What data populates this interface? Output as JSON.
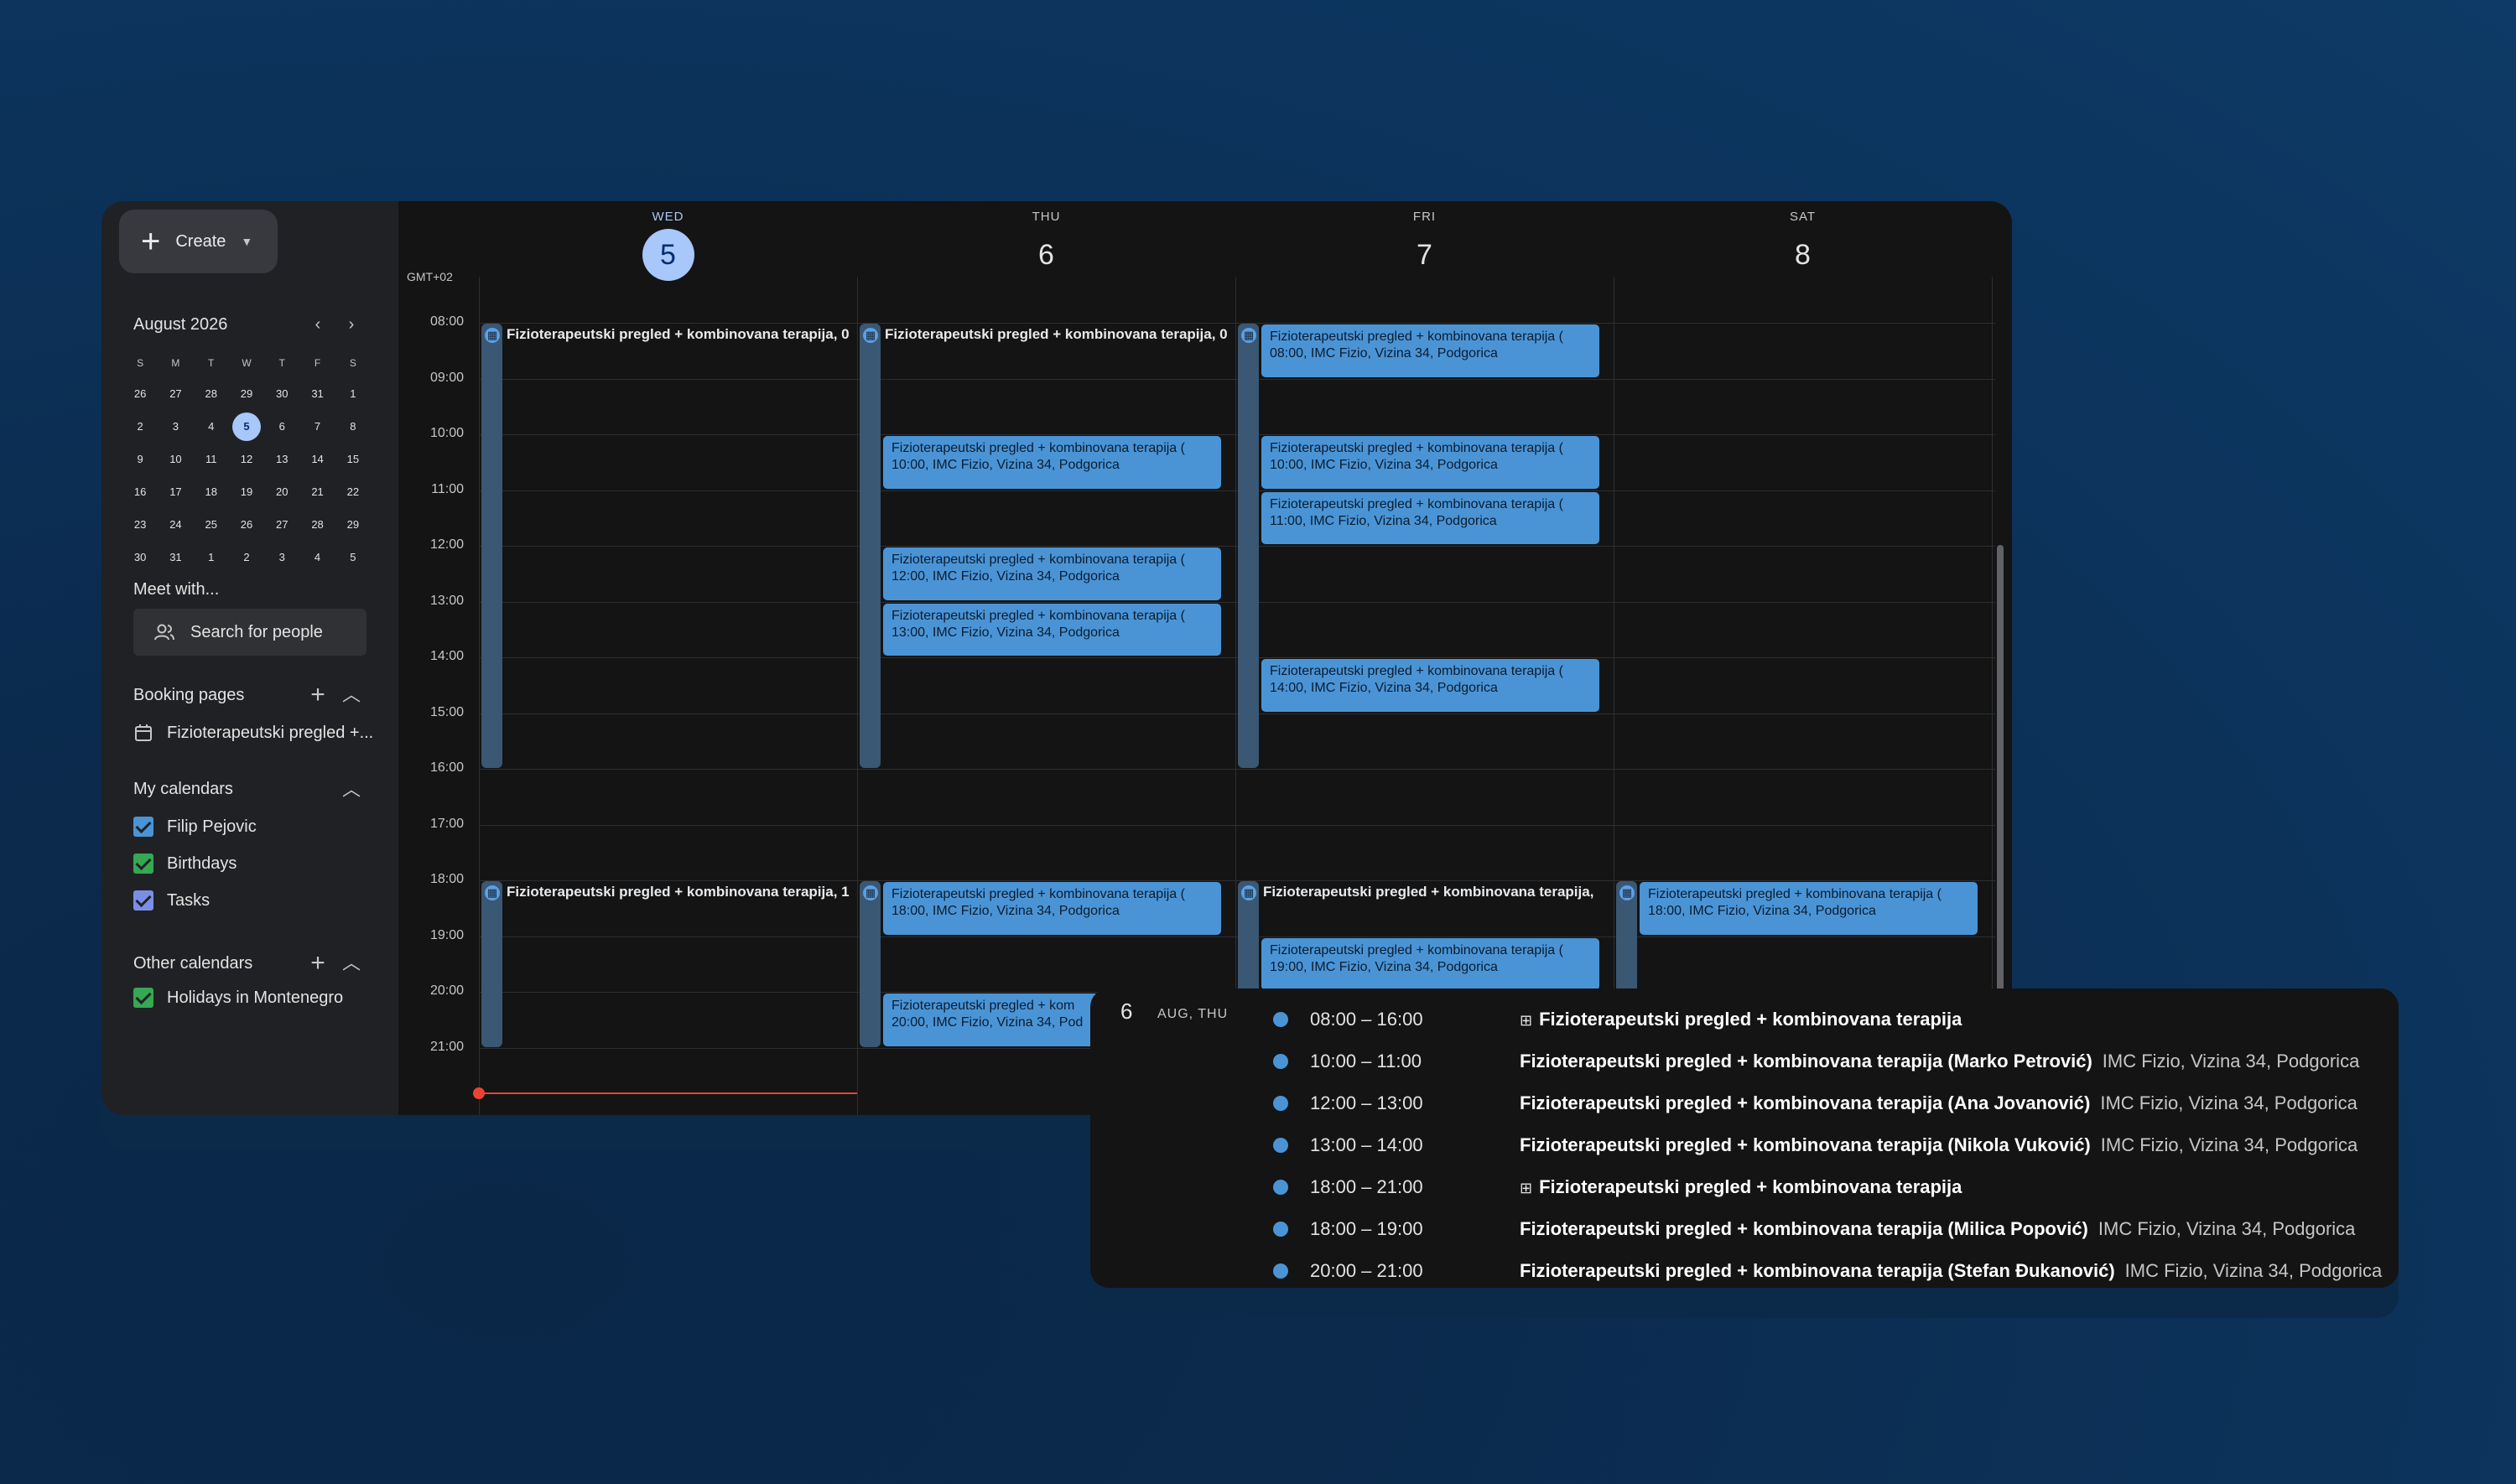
{
  "sidebar": {
    "create_label": "Create",
    "mini_calendar": {
      "month_label": "August 2026",
      "prev_icon": "‹",
      "next_icon": "›",
      "dows": [
        "S",
        "M",
        "T",
        "W",
        "T",
        "F",
        "S"
      ],
      "weeks": [
        [
          "26",
          "27",
          "28",
          "29",
          "30",
          "31",
          "1"
        ],
        [
          "2",
          "3",
          "4",
          "5",
          "6",
          "7",
          "8"
        ],
        [
          "9",
          "10",
          "11",
          "12",
          "13",
          "14",
          "15"
        ],
        [
          "16",
          "17",
          "18",
          "19",
          "20",
          "21",
          "22"
        ],
        [
          "23",
          "24",
          "25",
          "26",
          "27",
          "28",
          "29"
        ],
        [
          "30",
          "31",
          "1",
          "2",
          "3",
          "4",
          "5"
        ]
      ],
      "today": "5"
    },
    "meet_with": "Meet with...",
    "search_placeholder": "Search for people",
    "booking_pages": {
      "title": "Booking pages",
      "items": [
        "Fizioterapeutski pregled +..."
      ]
    },
    "my_calendars": {
      "title": "My calendars",
      "items": [
        {
          "label": "Filip Pejovic",
          "color": "#4a94d6"
        },
        {
          "label": "Birthdays",
          "color": "#34a853"
        },
        {
          "label": "Tasks",
          "color": "#7b8ee6"
        }
      ]
    },
    "other_calendars": {
      "title": "Other calendars",
      "items": [
        {
          "label": "Holidays in Montenegro",
          "color": "#34a853"
        }
      ]
    }
  },
  "grid": {
    "timezone": "GMT+02",
    "days": [
      {
        "dow": "WED",
        "num": "5",
        "today": true
      },
      {
        "dow": "THU",
        "num": "6",
        "today": false
      },
      {
        "dow": "FRI",
        "num": "7",
        "today": false
      },
      {
        "dow": "SAT",
        "num": "8",
        "today": false
      }
    ],
    "hours": [
      "08:00",
      "09:00",
      "10:00",
      "11:00",
      "12:00",
      "13:00",
      "14:00",
      "15:00",
      "16:00",
      "17:00",
      "18:00",
      "19:00",
      "20:00",
      "21:00"
    ],
    "allday_blocks": [
      {
        "day": 0,
        "start": 8,
        "end": 16,
        "title": "Fizioterapeutski pregled + kombinovana terapija, 0"
      },
      {
        "day": 1,
        "start": 8,
        "end": 16,
        "title": "Fizioterapeutski pregled + kombinovana terapija, 0"
      },
      {
        "day": 2,
        "start": 8,
        "end": 16,
        "title": ""
      },
      {
        "day": 0,
        "start": 18,
        "end": 21,
        "title": "Fizioterapeutski pregled + kombinovana terapija, 1"
      },
      {
        "day": 1,
        "start": 18,
        "end": 21,
        "title": ""
      },
      {
        "day": 2,
        "start": 18,
        "end": 21,
        "title": "Fizioterapeutski pregled + kombinovana terapija,"
      },
      {
        "day": 3,
        "start": 18,
        "end": 21,
        "title": ""
      }
    ],
    "events": [
      {
        "day": 2,
        "start": 8,
        "l1": "Fizioterapeutski pregled + kombinovana terapija (",
        "l2": "08:00, IMC Fizio, Vizina 34, Podgorica"
      },
      {
        "day": 1,
        "start": 10,
        "l1": "Fizioterapeutski pregled + kombinovana terapija (",
        "l2": "10:00, IMC Fizio, Vizina 34, Podgorica"
      },
      {
        "day": 2,
        "start": 10,
        "l1": "Fizioterapeutski pregled + kombinovana terapija (",
        "l2": "10:00, IMC Fizio, Vizina 34, Podgorica"
      },
      {
        "day": 2,
        "start": 11,
        "l1": "Fizioterapeutski pregled + kombinovana terapija (",
        "l2": "11:00, IMC Fizio, Vizina 34, Podgorica"
      },
      {
        "day": 1,
        "start": 12,
        "l1": "Fizioterapeutski pregled + kombinovana terapija (",
        "l2": "12:00, IMC Fizio, Vizina 34, Podgorica"
      },
      {
        "day": 1,
        "start": 13,
        "l1": "Fizioterapeutski pregled + kombinovana terapija (",
        "l2": "13:00, IMC Fizio, Vizina 34, Podgorica"
      },
      {
        "day": 2,
        "start": 14,
        "l1": "Fizioterapeutski pregled + kombinovana terapija (",
        "l2": "14:00, IMC Fizio, Vizina 34, Podgorica"
      },
      {
        "day": 1,
        "start": 18,
        "l1": "Fizioterapeutski pregled + kombinovana terapija (",
        "l2": "18:00, IMC Fizio, Vizina 34, Podgorica"
      },
      {
        "day": 3,
        "start": 18,
        "l1": "Fizioterapeutski pregled + kombinovana terapija (",
        "l2": "18:00, IMC Fizio, Vizina 34, Podgorica"
      },
      {
        "day": 2,
        "start": 19,
        "l1": "Fizioterapeutski pregled + kombinovana terapija (",
        "l2": "19:00, IMC Fizio, Vizina 34, Podgorica"
      },
      {
        "day": 1,
        "start": 20,
        "l1": "Fizioterapeutski pregled + kom",
        "l2": "20:00, IMC Fizio, Vizina 34, Pod"
      }
    ]
  },
  "agenda": {
    "day_num": "6",
    "day_label": "AUG, THU",
    "rows": [
      {
        "time": "08:00 – 16:00",
        "allday_icon": true,
        "title": "Fizioterapeutski pregled + kombinovana terapija",
        "location": ""
      },
      {
        "time": "10:00 – 11:00",
        "allday_icon": false,
        "title": "Fizioterapeutski pregled + kombinovana terapija (Marko Petrović)",
        "location": "IMC Fizio, Vizina 34, Podgorica"
      },
      {
        "time": "12:00 – 13:00",
        "allday_icon": false,
        "title": "Fizioterapeutski pregled + kombinovana terapija (Ana Jovanović)",
        "location": "IMC Fizio, Vizina 34, Podgorica"
      },
      {
        "time": "13:00 – 14:00",
        "allday_icon": false,
        "title": "Fizioterapeutski pregled + kombinovana terapija (Nikola Vuković)",
        "location": "IMC Fizio, Vizina 34, Podgorica"
      },
      {
        "time": "18:00 – 21:00",
        "allday_icon": true,
        "title": "Fizioterapeutski pregled + kombinovana terapija",
        "location": ""
      },
      {
        "time": "18:00 – 19:00",
        "allday_icon": false,
        "title": "Fizioterapeutski pregled + kombinovana terapija (Milica Popović)",
        "location": "IMC Fizio, Vizina 34, Podgorica"
      },
      {
        "time": "20:00 – 21:00",
        "allday_icon": false,
        "title": "Fizioterapeutski pregled + kombinovana terapija (Stefan Đukanović)",
        "location": "IMC Fizio, Vizina 34, Podgorica"
      }
    ]
  },
  "colors": {
    "accent": "#a8c7fa",
    "event": "#4a94d6",
    "now": "#ea4335"
  }
}
